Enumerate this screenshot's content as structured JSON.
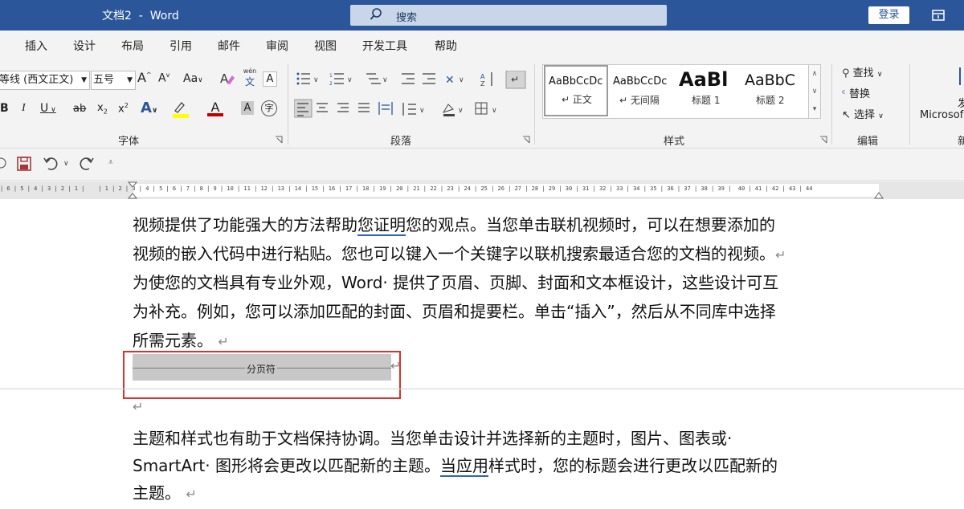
{
  "app": {
    "window_title": "文档2  -  Word",
    "search_label": "搜索",
    "login_label": "登录"
  },
  "tabs": [
    "插入",
    "设计",
    "布局",
    "引用",
    "邮件",
    "审阅",
    "视图",
    "开发工具",
    "帮助"
  ],
  "font_group": {
    "label": "字体",
    "font_name": "等线 (西文正文)",
    "font_size": "五号",
    "grow": "A",
    "shrink": "A",
    "change_case": "Aa",
    "phonetic_top": "wén",
    "phonetic_bottom": "文",
    "border_char": "A",
    "bold": "B",
    "italic": "I",
    "underline": "U",
    "strike": "ab",
    "subscript": "x",
    "superscript": "x",
    "text_effects": "A",
    "font_color": "A",
    "shading_char": "A",
    "enclose": "字"
  },
  "paragraph_group": {
    "label": "段落"
  },
  "styles_group": {
    "label": "样式",
    "styles": [
      {
        "preview": "AaBbCcDc",
        "name": "↵ 正文"
      },
      {
        "preview": "AaBbCcDc",
        "name": "↵ 无间隔"
      },
      {
        "preview": "AaBl",
        "name": "标题 1"
      },
      {
        "preview": "AaBbC",
        "name": "标题 2"
      }
    ]
  },
  "editing_group": {
    "label": "编辑",
    "find": "查找",
    "replace": "替换",
    "select": "选择"
  },
  "right_clip": {
    "line1": "Microsof",
    "line2": "发",
    "line3": "新"
  },
  "ruler": {
    "text": "| 6 | 5 | 4 | 3 | 2 | 1 |    | 1 | 2 | 3 | 4 | 5 | 6 | 7 | 8 | 9 | 10 | 11 | 12 | 13 | 14 | 15 | 16 | 17 | 18 | 19 | 20 | 21 | 22 | 23 | 24 | 25 | 26 | 27 | 28 | 29 | 30 | 31 | 32 | 33 | 34 | 35 | 36 | 37 | 38 | 39 |  40 | 41 | 42 | 43 | 44"
  },
  "document": {
    "p1a": "视频提供了功能强大的方法帮助",
    "p1_link1": "您证明",
    "p1b": "您的观点。当您单击联机视频时，可以在想要添加的",
    "p1_line2": "视频的嵌入代码中进行粘贴。您也可以键入一个关键字以联机搜索最适合您的文档的视频。",
    "p2_line1": "为使您的文档具有专业外观，Word· 提供了页眉、页脚、封面和文本框设计，这些设计可互",
    "p2_line2": "为补充。例如，您可以添加匹配的封面、页眉和提要栏。单击“插入”，然后从不同库中选择",
    "p2_line3": "所需元素。",
    "page_break_label": "分页符",
    "p3_line1": "主题和样式也有助于文档保持协调。当您单击设计并选择新的主题时，图片、图表或·",
    "p3_line2a": "SmartArt· 图形将会更改以匹配新的主题。",
    "p3_link": "当应用",
    "p3_line2b": "样式时，您的标题会进行更改以匹配新的",
    "p3_line3": "主题。"
  },
  "colors": {
    "title_bar": "#2b579a",
    "highlight": "#ffff00",
    "font_color": "#c00000",
    "selection_box": "#d9322d",
    "link_underline": "#2f64b4"
  }
}
